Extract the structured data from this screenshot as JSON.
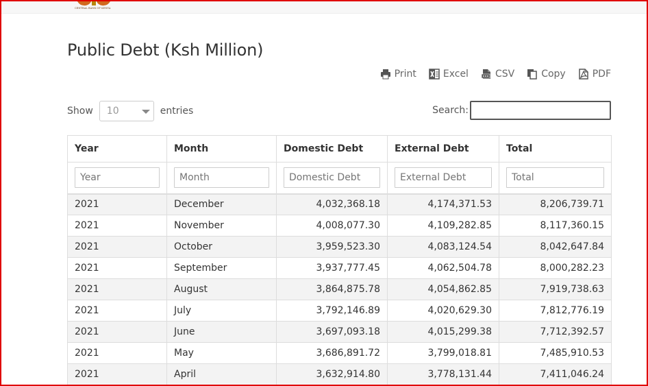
{
  "header": {
    "logo_text": "CENTRAL BANK OF KENYA"
  },
  "page": {
    "title": "Public Debt (Ksh Million)"
  },
  "export_buttons": [
    {
      "label": "Print",
      "icon": "print-icon"
    },
    {
      "label": "Excel",
      "icon": "excel-icon"
    },
    {
      "label": "CSV",
      "icon": "csv-icon"
    },
    {
      "label": "Copy",
      "icon": "copy-icon"
    },
    {
      "label": "PDF",
      "icon": "pdf-icon"
    }
  ],
  "length": {
    "show_label": "Show",
    "value": "10",
    "entries_label": "entries"
  },
  "search": {
    "label": "Search:",
    "value": ""
  },
  "table": {
    "columns": [
      "Year",
      "Month",
      "Domestic Debt",
      "External Debt",
      "Total"
    ],
    "filter_placeholders": [
      "Year",
      "Month",
      "Domestic Debt",
      "External Debt",
      "Total"
    ],
    "rows": [
      [
        "2021",
        "December",
        "4,032,368.18",
        "4,174,371.53",
        "8,206,739.71"
      ],
      [
        "2021",
        "November",
        "4,008,077.30",
        "4,109,282.85",
        "8,117,360.15"
      ],
      [
        "2021",
        "October",
        "3,959,523.30",
        "4,083,124.54",
        "8,042,647.84"
      ],
      [
        "2021",
        "September",
        "3,937,777.45",
        "4,062,504.78",
        "8,000,282.23"
      ],
      [
        "2021",
        "August",
        "3,864,875.78",
        "4,054,862.85",
        "7,919,738.63"
      ],
      [
        "2021",
        "July",
        "3,792,146.89",
        "4,020,629.30",
        "7,812,776.19"
      ],
      [
        "2021",
        "June",
        "3,697,093.18",
        "4,015,299.38",
        "7,712,392.57"
      ],
      [
        "2021",
        "May",
        "3,686,891.72",
        "3,799,018.81",
        "7,485,910.53"
      ],
      [
        "2021",
        "April",
        "3,632,914.80",
        "3,778,131.44",
        "7,411,046.24"
      ]
    ]
  },
  "colors": {
    "frame": "#e00000",
    "stripe": "#f3f3f3",
    "border": "#dddddd"
  }
}
